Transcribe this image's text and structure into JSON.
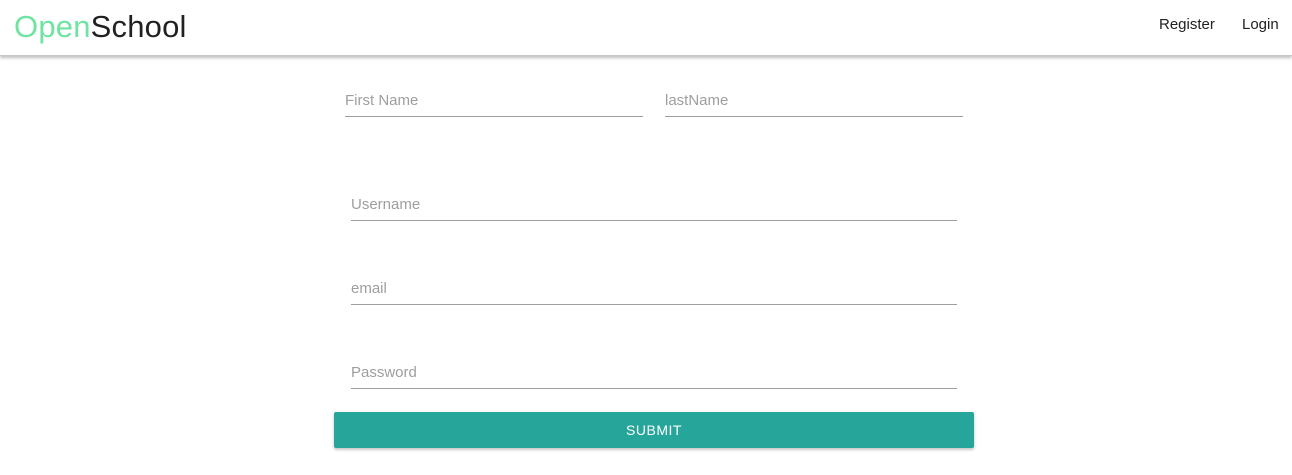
{
  "header": {
    "brand_part1": "Open",
    "brand_part2": "School",
    "brand_color_part1": "#6fe3a1",
    "links": [
      {
        "label": "Register"
      },
      {
        "label": "Login"
      }
    ]
  },
  "form": {
    "first_name": {
      "placeholder": "First Name",
      "value": ""
    },
    "last_name": {
      "placeholder": "lastName",
      "value": ""
    },
    "username": {
      "placeholder": "Username",
      "value": ""
    },
    "email": {
      "placeholder": "email",
      "value": ""
    },
    "password": {
      "placeholder": "Password",
      "value": ""
    },
    "submit_label": "SUBMIT",
    "submit_color": "#26a69a"
  }
}
